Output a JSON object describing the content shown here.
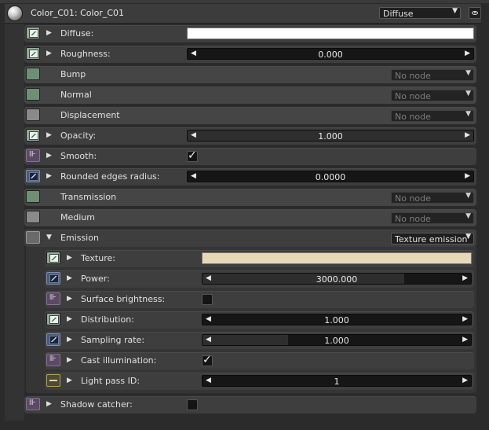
{
  "header": {
    "title": "Color_C01: Color_C01",
    "material_type": "Diffuse"
  },
  "rows": {
    "diffuse": {
      "label": "Diffuse:"
    },
    "roughness": {
      "label": "Roughness:",
      "value": "0.000"
    },
    "bump": {
      "label": "Bump",
      "node": "No node"
    },
    "normal": {
      "label": "Normal",
      "node": "No node"
    },
    "displacement": {
      "label": "Displacement",
      "node": "No node"
    },
    "opacity": {
      "label": "Opacity:",
      "value": "1.000"
    },
    "smooth": {
      "label": "Smooth:",
      "checked": true
    },
    "rounded": {
      "label": "Rounded edges radius:",
      "value": "0.0000"
    },
    "transmission": {
      "label": "Transmission",
      "node": "No node"
    },
    "medium": {
      "label": "Medium",
      "node": "No node"
    },
    "emission": {
      "label": "Emission",
      "node": "Texture emission"
    },
    "texture": {
      "label": "Texture:",
      "color": "#e6d9b8"
    },
    "power": {
      "label": "Power:",
      "value": "3000.000",
      "level": 0.75
    },
    "surface_brightness": {
      "label": "Surface brightness:",
      "checked": false
    },
    "distribution": {
      "label": "Distribution:",
      "value": "1.000"
    },
    "sampling_rate": {
      "label": "Sampling rate:",
      "value": "1.000",
      "level": 0.32
    },
    "cast_illumination": {
      "label": "Cast illumination:",
      "checked": true
    },
    "light_pass_id": {
      "label": "Light pass ID:",
      "value": "1"
    },
    "shadow_catcher": {
      "label": "Shadow catcher:",
      "checked": false
    }
  },
  "icons": {
    "checkmark": "✓",
    "left_arrow": "◀",
    "right_arrow": "▶",
    "expand_right": "▶",
    "expand_down": "▼",
    "dropdown": "▼"
  }
}
